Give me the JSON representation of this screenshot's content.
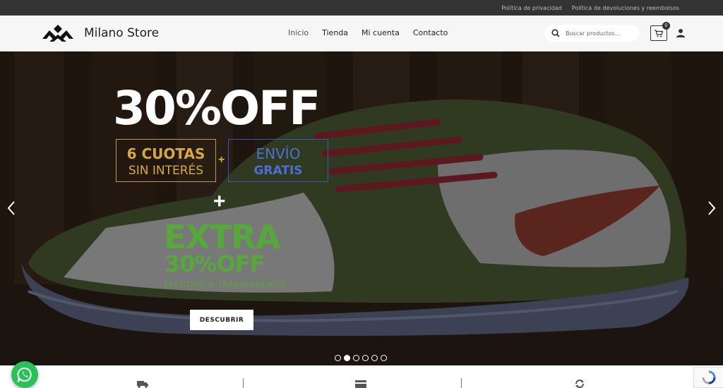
{
  "topbar": {
    "links": [
      "Política de privacidad",
      "Política de devoluciones y reembolsos"
    ]
  },
  "header": {
    "brand": "Milano Store",
    "nav": [
      "Inicio",
      "Tienda",
      "Mi cuenta",
      "Contacto"
    ],
    "search_placeholder": "Buscar productos…",
    "cart_count": "0"
  },
  "hero": {
    "title": "30%OFF",
    "cuotas_line1": "6 CUOTAS",
    "cuotas_line2": "SIN INTERÉS",
    "envio_line1": "ENVÍO",
    "envio_line2": "GRATIS",
    "plus": "+",
    "extra_line1": "EXTRA",
    "extra_line2": "30%OFF",
    "extra_sub": "EFECTIVO O TRANSFERENCIA",
    "cta": "DESCUBRIR",
    "slide_count": 6,
    "active_slide": 2
  },
  "colors": {
    "cuotas": "#d8a93a",
    "envio": "#4d6ed6",
    "extra": "#56a83a",
    "whatsapp": "#29c259"
  },
  "icons": [
    "search-icon",
    "cart-icon",
    "user-icon",
    "chevron-left-icon",
    "chevron-right-icon",
    "truck-icon",
    "card-icon",
    "refresh-icon",
    "whatsapp-icon",
    "recaptcha-icon"
  ]
}
